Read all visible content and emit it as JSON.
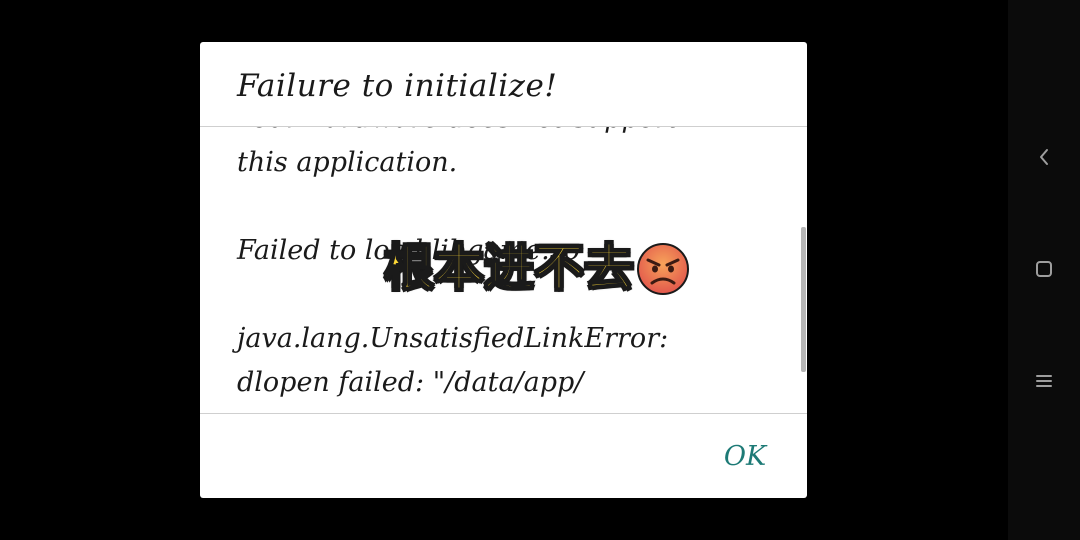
{
  "dialog": {
    "title": "Failure to initialize!",
    "message_lines": [
      "Your hardware does not support",
      "this application.",
      "",
      "Failed to load libgame.so",
      "",
      "java.lang.UnsatisfiedLinkError:",
      "dlopen failed: \"/data/app/"
    ],
    "ok_label": "OK"
  },
  "overlay": {
    "caption": "根本进不去",
    "emoji": "angry-face"
  },
  "navbar": {
    "back_icon": "back-chevron-icon",
    "home_icon": "home-square-icon",
    "menu_icon": "menu-lines-icon"
  },
  "colors": {
    "ok_accent": "#1d7a76",
    "caption": "#fdd835",
    "emoji_face": "#e2574c"
  }
}
